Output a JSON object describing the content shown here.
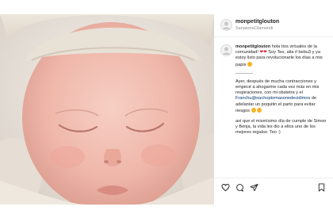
{
  "post": {
    "username": "monpetitglouton",
    "location": "SanatorioOtamendi"
  },
  "caption": {
    "username": "monpetitglouton",
    "p1_text": "hola tíos virtuales de la comunidad! ",
    "p1_text2": " Soy Teo, alia # bebu3 y ya estoy listo para revolucionarle los días a mis papis ",
    "p2_text": "Ayer, después de mucha contracciones y empecé a ahogarme cada vez más en mis respiraciones, con mi obstetra y el",
    "p2_mention": "Franchu@nachoptomasonedecidimos",
    "p2_text2": " de adelantar un poquitin el parto para evitar riesgos ",
    "p3_text": "así que el mismísimo día de cumple de Simon y Benja, la vida les dio a ellos uno de los mejores regalos: Teo :)"
  },
  "emoji": {
    "heart": "❤"
  },
  "icons": {
    "like": "heart-outline-icon",
    "comment": "comment-icon",
    "share": "share-icon",
    "save": "bookmark-icon"
  },
  "colors": {
    "heart": "#d6213a",
    "mention": "#003569",
    "muted": "#8e8e8e"
  }
}
